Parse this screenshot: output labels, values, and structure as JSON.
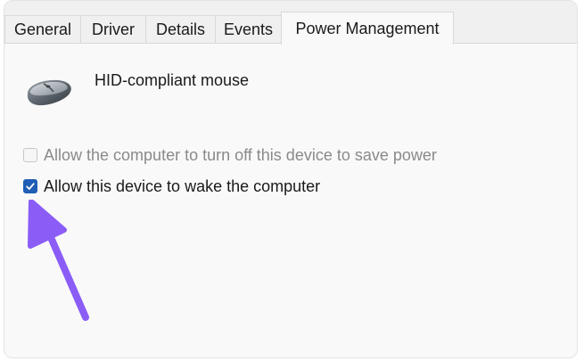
{
  "tabs": [
    {
      "label": "General",
      "active": false
    },
    {
      "label": "Driver",
      "active": false
    },
    {
      "label": "Details",
      "active": false
    },
    {
      "label": "Events",
      "active": false
    },
    {
      "label": "Power Management",
      "active": true
    }
  ],
  "device": {
    "name": "HID-compliant mouse",
    "icon": "mouse-icon"
  },
  "options": [
    {
      "label": "Allow the computer to turn off this device to save power",
      "checked": false,
      "enabled": false
    },
    {
      "label": "Allow this device to wake the computer",
      "checked": true,
      "enabled": true
    }
  ],
  "annotation": {
    "icon": "arrow-icon",
    "color": "#8b5cf6"
  },
  "colors": {
    "accent": "#1f5eb4",
    "disabled_text": "#8a8a8a"
  }
}
